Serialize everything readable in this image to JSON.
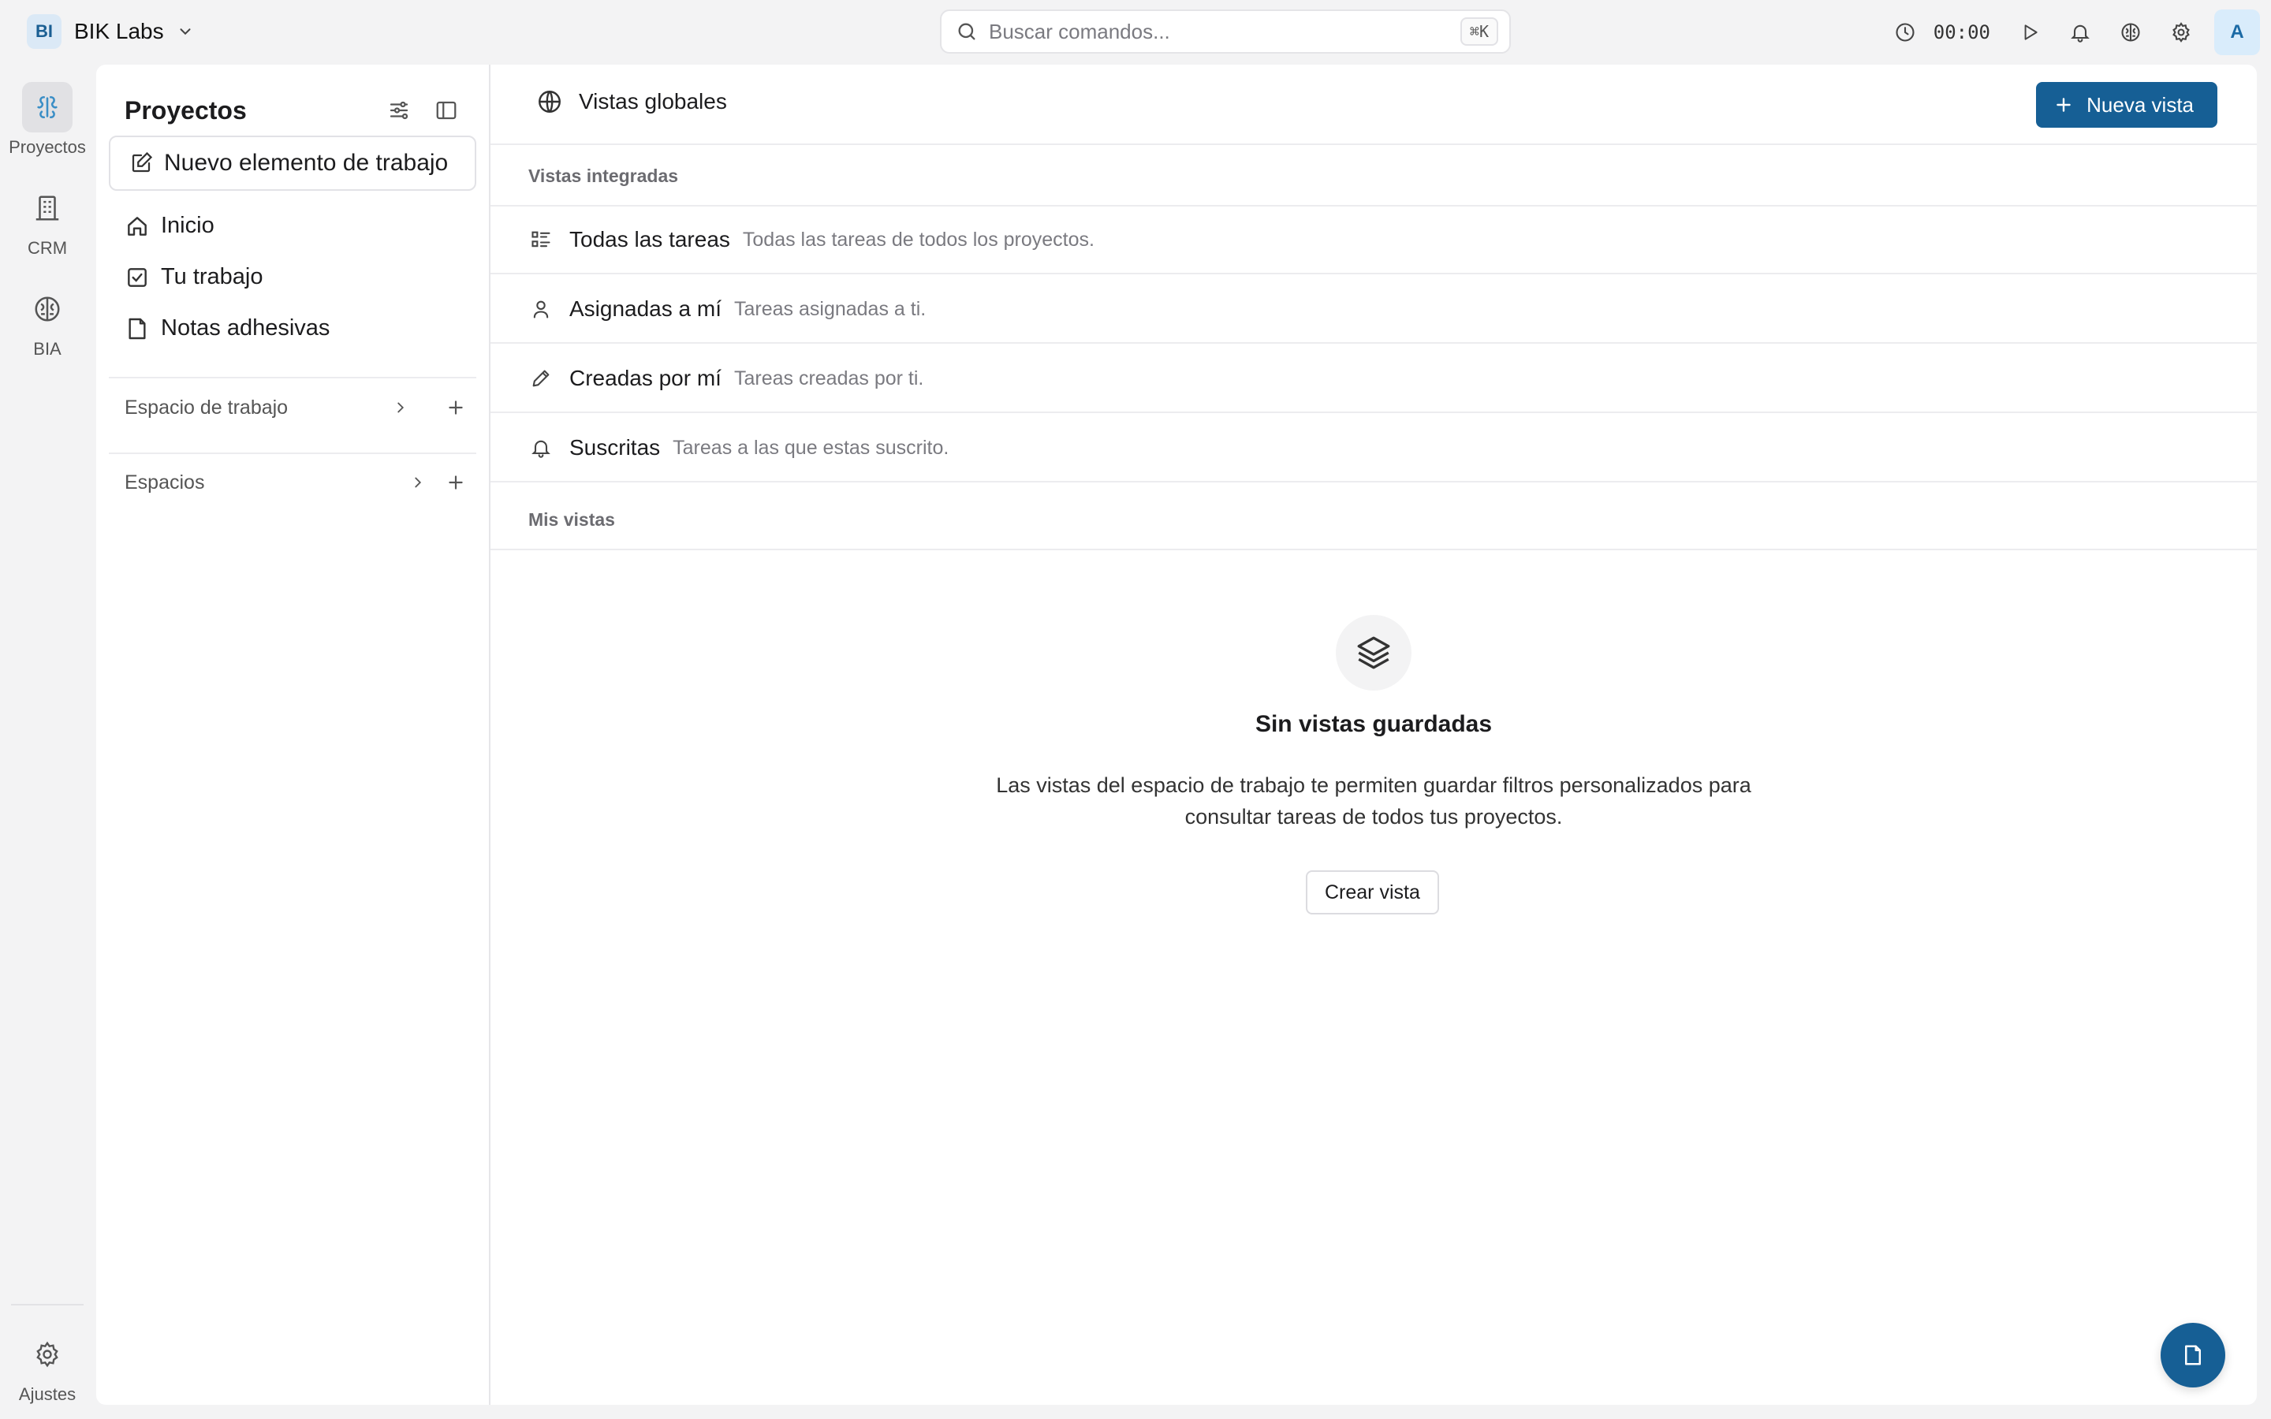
{
  "workspace": {
    "badge": "BI",
    "name": "BIK Labs"
  },
  "search": {
    "placeholder": "Buscar comandos...",
    "shortcut": "⌘K"
  },
  "topbar": {
    "timer": "00:00",
    "avatar": "A"
  },
  "rail": {
    "items": [
      {
        "label": "Proyectos",
        "icon": "projects-icon",
        "active": true
      },
      {
        "label": "CRM",
        "icon": "building-icon"
      },
      {
        "label": "BIA",
        "icon": "brain-icon"
      }
    ],
    "settings_label": "Ajustes"
  },
  "sidebar": {
    "title": "Proyectos",
    "new_item": "Nuevo elemento de trabajo",
    "nav": [
      {
        "label": "Inicio",
        "icon": "home-icon"
      },
      {
        "label": "Tu trabajo",
        "icon": "checkbox-icon"
      },
      {
        "label": "Notas adhesivas",
        "icon": "note-icon"
      }
    ],
    "sections": [
      {
        "label": "Espacio de trabajo"
      },
      {
        "label": "Espacios"
      }
    ]
  },
  "main": {
    "title": "Vistas globales",
    "new_view_button": "Nueva vista",
    "builtin_label": "Vistas integradas",
    "views": [
      {
        "name": "Todas las tareas",
        "desc": "Todas las tareas de todos los proyectos.",
        "icon": "list-icon"
      },
      {
        "name": "Asignadas a mí",
        "desc": "Tareas asignadas a ti.",
        "icon": "user-icon"
      },
      {
        "name": "Creadas por mí",
        "desc": "Tareas creadas por ti.",
        "icon": "pencil-icon"
      },
      {
        "name": "Suscritas",
        "desc": "Tareas a las que estas suscrito.",
        "icon": "bell-icon"
      }
    ],
    "my_views_label": "Mis vistas",
    "empty": {
      "title": "Sin vistas guardadas",
      "desc": "Las vistas del espacio de trabajo te permiten guardar filtros personalizados para consultar tareas de todos tus proyectos.",
      "button": "Crear vista"
    }
  },
  "colors": {
    "primary": "#165f95",
    "active_rail": "#3a8ec6"
  }
}
